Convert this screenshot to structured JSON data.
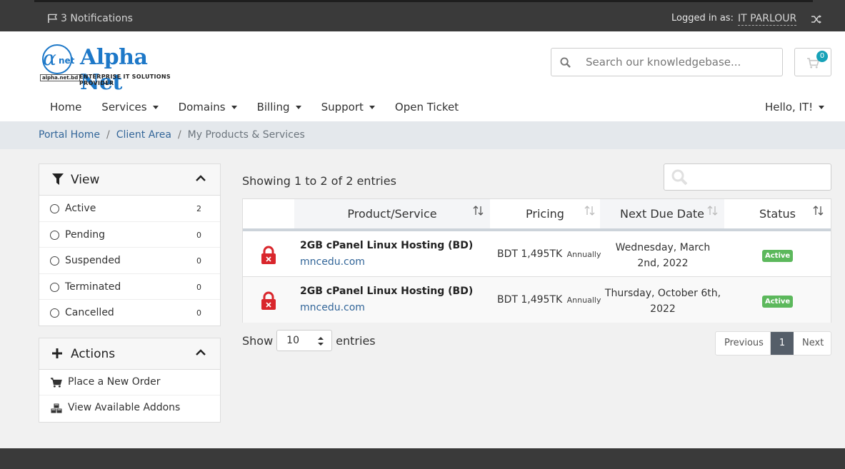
{
  "topbar": {
    "notifications_label": "3 Notifications",
    "logged_in_label": "Logged in as:",
    "user_name": "IT PARLOUR"
  },
  "logo": {
    "name": "Alpha Net",
    "tagline": "ENTERPRISE IT SOLUTIONS PROVIDER",
    "url": "alpha.net.bd",
    "mark": "net"
  },
  "search": {
    "placeholder": "Search our knowledgebase..."
  },
  "cart": {
    "count": "0"
  },
  "nav": {
    "items": [
      {
        "label": "Home",
        "dropdown": false
      },
      {
        "label": "Services",
        "dropdown": true
      },
      {
        "label": "Domains",
        "dropdown": true
      },
      {
        "label": "Billing",
        "dropdown": true
      },
      {
        "label": "Support",
        "dropdown": true
      },
      {
        "label": "Open Ticket",
        "dropdown": false
      }
    ],
    "greeting": "Hello, IT!"
  },
  "breadcrumb": {
    "items": [
      "Portal Home",
      "Client Area"
    ],
    "current": "My Products & Services",
    "separator": "/"
  },
  "view_panel": {
    "title": "View",
    "filters": [
      {
        "label": "Active",
        "count": "2"
      },
      {
        "label": "Pending",
        "count": "0"
      },
      {
        "label": "Suspended",
        "count": "0"
      },
      {
        "label": "Terminated",
        "count": "0"
      },
      {
        "label": "Cancelled",
        "count": "0"
      }
    ]
  },
  "actions_panel": {
    "title": "Actions",
    "items": [
      {
        "label": "Place a New Order",
        "icon": "cart-icon"
      },
      {
        "label": "View Available Addons",
        "icon": "cubes-icon"
      }
    ]
  },
  "table": {
    "showing_text": "Showing 1 to 2 of 2 entries",
    "columns": [
      "Product/Service",
      "Pricing",
      "Next Due Date",
      "Status"
    ],
    "rows": [
      {
        "product": "2GB cPanel Linux Hosting (BD)",
        "domain": "mncedu.com",
        "price": "BDT 1,495TK",
        "cycle": "Annually",
        "due_line1": "Wednesday, March",
        "due_line2": "2nd, 2022",
        "status": "Active"
      },
      {
        "product": "2GB cPanel Linux Hosting (BD)",
        "domain": "mncedu.com",
        "price": "BDT 1,495TK",
        "cycle": "Annually",
        "due_line1": "Thursday, October 6th,",
        "due_line2": "2022",
        "status": "Active"
      }
    ],
    "length": {
      "show_label": "Show",
      "value": "10",
      "entries_label": "entries"
    },
    "pagination": {
      "previous": "Previous",
      "current": "1",
      "next": "Next"
    }
  },
  "colors": {
    "topbar_bg": "#3a3a3a",
    "link": "#336699",
    "status_active": "#5cb85c",
    "cart_badge": "#17a2b8",
    "pager_current": "#555e69",
    "lock": "#d9262c"
  }
}
